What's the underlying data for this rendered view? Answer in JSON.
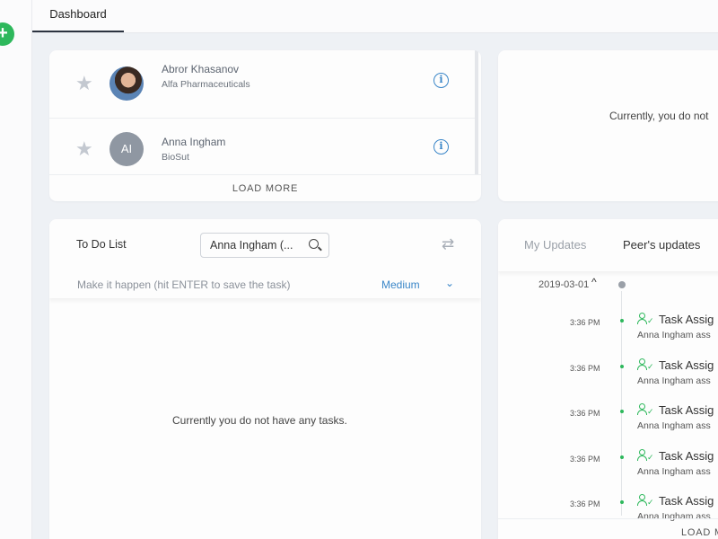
{
  "header": {
    "tab": "Dashboard"
  },
  "contacts": {
    "items": [
      {
        "name": "Abror Khasanov",
        "company": "Alfa Pharmaceuticals"
      },
      {
        "name": "Anna Ingham",
        "company": "BioSut",
        "initials": "AI"
      }
    ],
    "load_more": "LOAD MORE"
  },
  "notice": {
    "text": "Currently, you do not"
  },
  "todo": {
    "title": "To Do List",
    "search_value": "Anna Ingham (...",
    "input_placeholder": "Make it happen (hit ENTER to save the task)",
    "priority": "Medium",
    "empty": "Currently you do not have any tasks."
  },
  "updates": {
    "tabs": [
      "My Updates",
      "Peer's updates"
    ],
    "date": "2019-03-01",
    "items": [
      {
        "time": "3:36 PM",
        "title": "Task Assig",
        "desc": "Anna Ingham ass"
      },
      {
        "time": "3:36 PM",
        "title": "Task Assig",
        "desc": "Anna Ingham ass"
      },
      {
        "time": "3:36 PM",
        "title": "Task Assig",
        "desc": "Anna Ingham ass"
      },
      {
        "time": "3:36 PM",
        "title": "Task Assig",
        "desc": "Anna Ingham ass"
      },
      {
        "time": "3:36 PM",
        "title": "Task Assig",
        "desc": "Anna Ingham ass"
      }
    ],
    "load_more": "LOAD M"
  }
}
